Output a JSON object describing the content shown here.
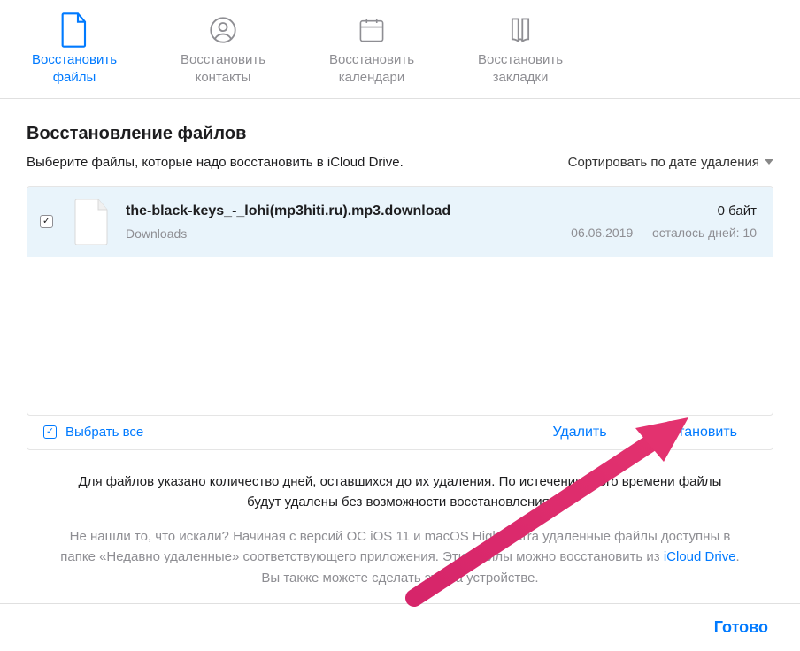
{
  "tabs": [
    {
      "label": "Восстановить\nфайлы",
      "active": true,
      "icon": "document-icon"
    },
    {
      "label": "Восстановить\nконтакты",
      "active": false,
      "icon": "contact-icon"
    },
    {
      "label": "Восстановить\nкалендари",
      "active": false,
      "icon": "calendar-icon"
    },
    {
      "label": "Восстановить\nзакладки",
      "active": false,
      "icon": "bookmark-icon"
    }
  ],
  "heading": "Восстановление файлов",
  "subtitle": "Выберите файлы, которые надо восстановить в iCloud Drive.",
  "sort_label": "Сортировать по дате удаления",
  "files": [
    {
      "name": "the-black-keys_-_lohi(mp3hiti.ru).mp3.download",
      "location": "Downloads",
      "size": "0 байт",
      "expiry": "06.06.2019 — осталось дней: 10",
      "checked": true
    }
  ],
  "select_all_label": "Выбрать все",
  "select_all_checked": true,
  "actions": {
    "delete": "Удалить",
    "restore": "Восстановить"
  },
  "info_primary": "Для файлов указано количество дней, оставшихся до их удаления. По истечении этого времени файлы будут удалены без возможности восстановления.",
  "info_secondary_a": "Не нашли то, что искали? Начиная с версий ОС iOS 11 и macOS High Sierra удаленные файлы доступны в папке «Недавно удаленные» соответствующего приложения. Эти файлы можно восстановить из ",
  "info_secondary_link": "iCloud Drive",
  "info_secondary_b": ". Вы также можете сделать это на устройстве.",
  "done": "Готово",
  "colors": {
    "accent": "#007aff",
    "arrow": "#d6256a"
  }
}
